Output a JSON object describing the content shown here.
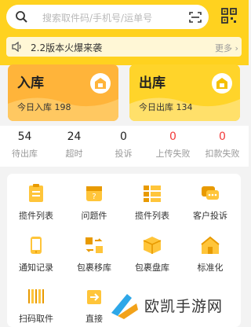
{
  "search": {
    "placeholder": "搜索取件码/手机号/运单号"
  },
  "notice": {
    "text": "2.2版本火爆来袭",
    "more_label": "更多"
  },
  "cards": [
    {
      "title": "入库",
      "sub": "今日入库 198"
    },
    {
      "title": "出库",
      "sub": "今日出库 134"
    }
  ],
  "stats": [
    {
      "value": "54",
      "label": "待出库",
      "highlight": false
    },
    {
      "value": "24",
      "label": "超时",
      "highlight": false
    },
    {
      "value": "0",
      "label": "投诉",
      "highlight": false
    },
    {
      "value": "0",
      "label": "上传失败",
      "highlight": true
    },
    {
      "value": "0",
      "label": "扣款失败",
      "highlight": true
    }
  ],
  "grid": [
    {
      "label": "揽件列表",
      "icon": "list-clipboard-icon"
    },
    {
      "label": "问题件",
      "icon": "problem-box-icon"
    },
    {
      "label": "揽件列表",
      "icon": "stack-list-icon"
    },
    {
      "label": "客户投诉",
      "icon": "chat-complaint-icon"
    },
    {
      "label": "通知记录",
      "icon": "phone-notify-icon"
    },
    {
      "label": "包裹移库",
      "icon": "move-parcel-icon"
    },
    {
      "label": "包裹盘库",
      "icon": "parcel-inventory-icon"
    },
    {
      "label": "标准化",
      "icon": "house-standard-icon"
    },
    {
      "label": "扫码取件",
      "icon": "barcode-scan-icon"
    },
    {
      "label": "直接",
      "icon": "direct-icon"
    }
  ],
  "watermark": {
    "text": "欧凯手游网"
  },
  "colors": {
    "brand": "#ffd21f",
    "orange": "#ffb43a",
    "red": "#f23a3a"
  }
}
